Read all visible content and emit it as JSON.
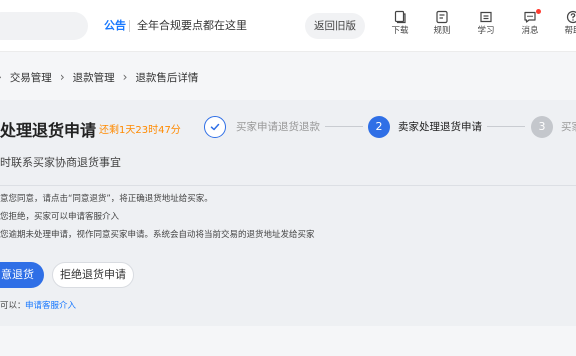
{
  "header": {
    "notice_tag": "公告",
    "notice_text": "全年合规要点都在这里",
    "back_old": "返回旧版",
    "tools": [
      {
        "label": "下载",
        "icon": "download-icon"
      },
      {
        "label": "规则",
        "icon": "rules-icon"
      },
      {
        "label": "学习",
        "icon": "learn-icon"
      },
      {
        "label": "消息",
        "icon": "message-icon"
      },
      {
        "label": "帮助",
        "icon": "help-icon"
      }
    ],
    "accent": "#1677ff",
    "badge_color": "#ff3b30"
  },
  "breadcrumb": {
    "items": [
      "交易管理",
      "退款管理",
      "退款售后详情"
    ]
  },
  "main": {
    "title": "处理退货申请",
    "countdown": "还剩1天23时47分",
    "subtitle": "时联系买家协商退货事宜",
    "notes": [
      "意您同意，请点击“同意退货”，将正确退货地址给买家。",
      "您拒绝，买家可以申请客服介入",
      "您逾期未处理申请，视作同意买家申请。系统会自动将当前交易的退货地址发给买家"
    ],
    "agree_button": "意退货",
    "reject_button": "拒绝退货申请",
    "help_prefix": "可以：",
    "help_link": "申请客服介入"
  },
  "steps": [
    {
      "number": "",
      "label": "买家申请退货退款",
      "state": "done"
    },
    {
      "number": "2",
      "label": "卖家处理退货申请",
      "state": "active"
    },
    {
      "number": "3",
      "label": "买家",
      "state": "pending"
    }
  ],
  "colors": {
    "primary": "#2f6fe6",
    "warning": "#ff8a00",
    "link": "#1677ff"
  }
}
